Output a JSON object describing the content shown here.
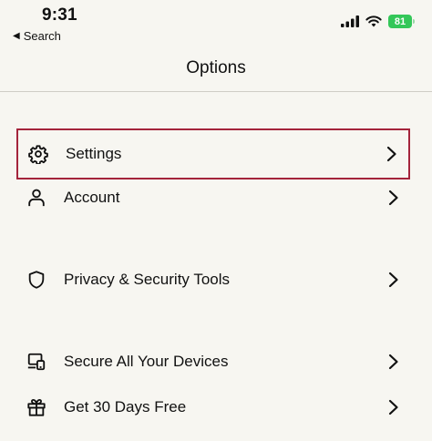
{
  "status_bar": {
    "time": "9:31",
    "back_label": "Search",
    "battery": "81"
  },
  "nav": {
    "title": "Options"
  },
  "menu": {
    "items": [
      {
        "label": "Settings",
        "icon": "gear-icon"
      },
      {
        "label": "Account",
        "icon": "person-icon"
      },
      {
        "label": "Privacy & Security Tools",
        "icon": "shield-icon"
      },
      {
        "label": "Secure All Your Devices",
        "icon": "devices-icon"
      },
      {
        "label": "Get 30 Days Free",
        "icon": "gift-icon"
      }
    ]
  },
  "colors": {
    "background": "#f7f6f1",
    "selection_border": "#a4243b",
    "battery": "#34c759"
  }
}
